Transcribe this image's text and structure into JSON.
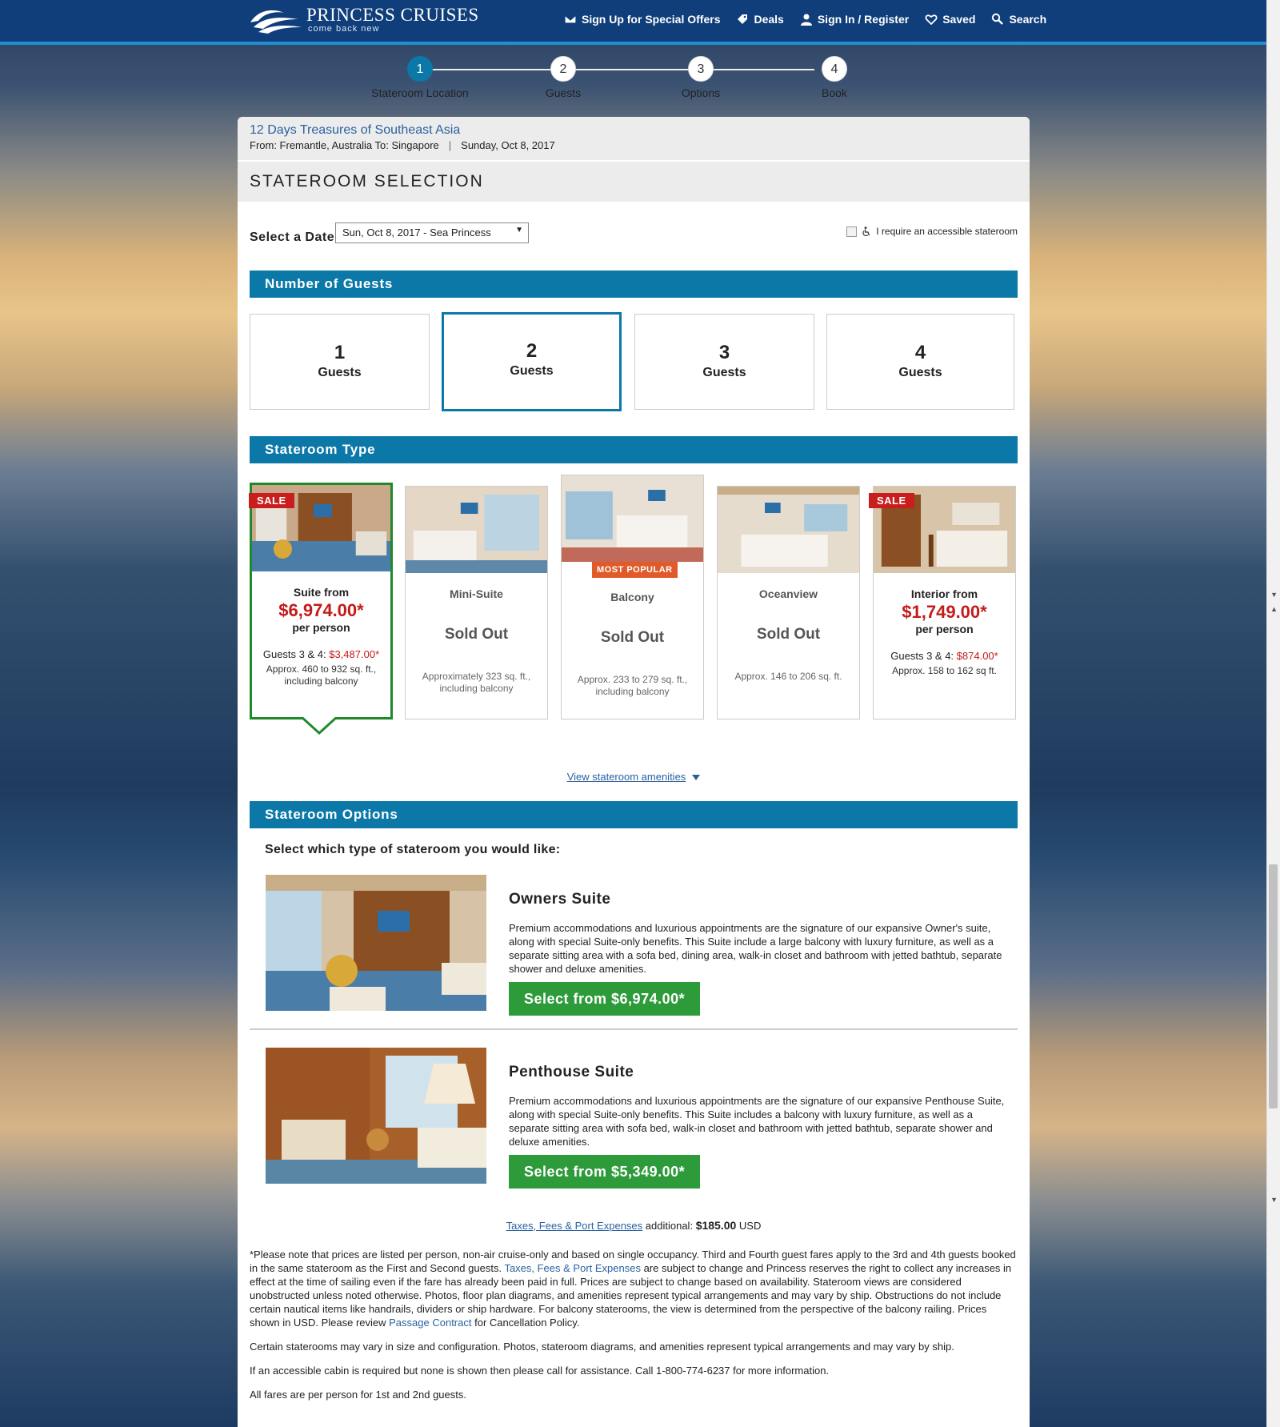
{
  "header": {
    "logo_name": "PRINCESS CRUISES",
    "logo_tag": "come back new",
    "nav": [
      {
        "label": "Sign Up for Special Offers",
        "icon": "envelope-icon"
      },
      {
        "label": "Deals",
        "icon": "tag-icon"
      },
      {
        "label": "Sign In / Register",
        "icon": "person-icon"
      },
      {
        "label": "Saved",
        "icon": "heart-icon"
      },
      {
        "label": "Search",
        "icon": "search-icon"
      }
    ]
  },
  "stepper": {
    "active": 1,
    "steps": [
      {
        "num": "1",
        "label": "Stateroom Location"
      },
      {
        "num": "2",
        "label": "Guests"
      },
      {
        "num": "3",
        "label": "Options"
      },
      {
        "num": "4",
        "label": "Book"
      }
    ]
  },
  "trip": {
    "title": "12 Days Treasures of Southeast Asia",
    "route": "From: Fremantle, Australia To: Singapore",
    "separator": "|",
    "date": "Sunday, Oct 8, 2017"
  },
  "selection": {
    "heading": "STATEROOM SELECTION",
    "date_label": "Select a Date",
    "date_value": "Sun, Oct 8, 2017 - Sea Princess",
    "accessible_label": "I require an accessible stateroom",
    "accessible_checked": false
  },
  "guests": {
    "heading": "Number of Guests",
    "selected": "2",
    "options": [
      {
        "num": "1",
        "label": "Guests"
      },
      {
        "num": "2",
        "label": "Guests"
      },
      {
        "num": "3",
        "label": "Guests"
      },
      {
        "num": "4",
        "label": "Guests"
      }
    ]
  },
  "stateroom_type": {
    "heading": "Stateroom Type",
    "cards": [
      {
        "name": "Suite from",
        "price": "$6,974.00*",
        "per": "per person",
        "extra_label": "Guests 3 & 4: ",
        "extra_price": "$3,487.00*",
        "size": "Approx. 460 to 932 sq. ft., including balcony",
        "badge": "SALE",
        "selected": true
      },
      {
        "name": "Mini-Suite",
        "status": "Sold Out",
        "size": "Approximately 323 sq. ft., including balcony"
      },
      {
        "name": "Balcony",
        "status": "Sold Out",
        "size": "Approx. 233 to 279 sq. ft., including balcony",
        "badge": "MOST POPULAR"
      },
      {
        "name": "Oceanview",
        "status": "Sold Out",
        "size": "Approx. 146 to 206 sq. ft."
      },
      {
        "name": "Interior from",
        "price": "$1,749.00*",
        "per": "per person",
        "extra_label": "Guests 3 & 4: ",
        "extra_price": "$874.00*",
        "size": "Approx. 158 to 162 sq ft.",
        "badge": "SALE"
      }
    ],
    "amenities_link": "View stateroom amenities"
  },
  "options": {
    "heading": "Stateroom Options",
    "intro": "Select which type of stateroom you would like:",
    "items": [
      {
        "title": "Owners Suite",
        "desc": "Premium accommodations and luxurious appointments are the signature of our expansive Owner's suite, along with special Suite-only benefits. This Suite include a large balcony with luxury furniture, as well as a separate sitting area with a sofa bed, dining area, walk-in closet and bathroom with jetted bathtub, separate shower and deluxe amenities.",
        "button": "Select from $6,974.00*"
      },
      {
        "title": "Penthouse Suite",
        "desc": "Premium accommodations and luxurious appointments are the signature of our expansive Penthouse Suite, along with special Suite-only benefits. This Suite includes a balcony with luxury furniture, as well as a separate sitting area with sofa bed, walk-in closet and bathroom with jetted bathtub, separate shower and deluxe amenities.",
        "button": "Select from $5,349.00*"
      }
    ]
  },
  "taxes": {
    "link": "Taxes, Fees & Port Expenses",
    "text": "additional:",
    "amount": "$185.00",
    "currency": "USD"
  },
  "fine_print": {
    "p1_a": "*Please note that prices are listed per person, non-air cruise-only and based on single occupancy. Third and Fourth guest fares apply to the 3rd and 4th guests booked in the same stateroom as the First and Second guests. ",
    "p1_link1": "Taxes, Fees & Port Expenses",
    "p1_b": " are subject to change and Princess reserves the right to collect any increases in effect at the time of sailing even if the fare has already been paid in full. Prices are subject to change based on availability. Stateroom views are considered unobstructed unless noted otherwise. Photos, floor plan diagrams, and amenities represent typical arrangements and may vary by ship. Obstructions do not include certain nautical items like handrails, dividers or ship hardware. For balcony staterooms, the view is determined from the perspective of the balcony railing. Prices shown in USD. Please review ",
    "p1_link2": "Passage Contract",
    "p1_c": " for Cancellation Policy.",
    "p2": "Certain staterooms may vary in size and configuration. Photos, stateroom diagrams, and amenities represent typical arrangements and may vary by ship.",
    "p3": "If an accessible cabin is required but none is shown then please call for assistance. Call 1-800-774-6237 for more information.",
    "p4": "All fares are per person for 1st and 2nd guests."
  },
  "colors": {
    "brand_navy": "#0f3e7a",
    "section_teal": "#0b78a8",
    "sale_red": "#c81e1e",
    "price_red": "#c41a1a",
    "select_green": "#2e9b3b",
    "popular_orange": "#e05a2a"
  }
}
